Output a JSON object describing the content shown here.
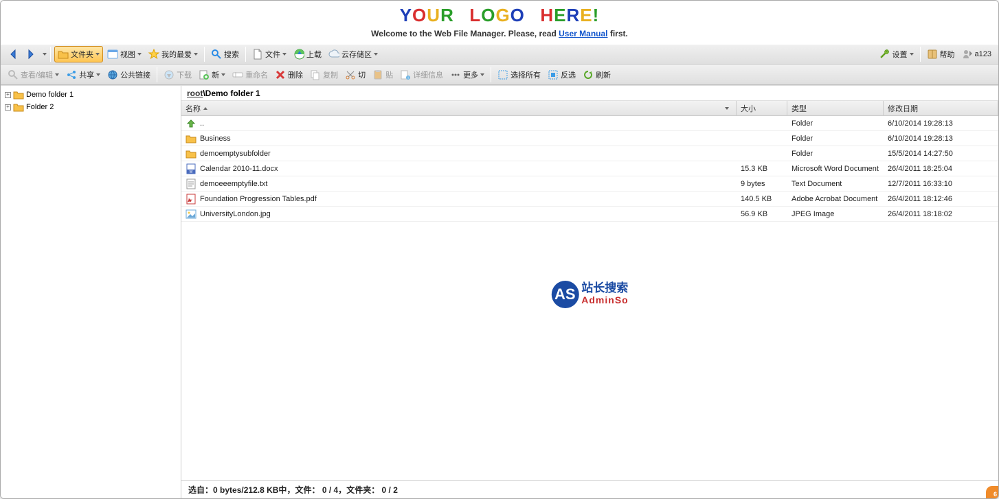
{
  "header": {
    "logo_text": "YOUR LOGO HERE!",
    "welcome_prefix": "Welcome to the Web File Manager. Please, read ",
    "welcome_link": "User Manual",
    "welcome_suffix": " first."
  },
  "toolbar1": {
    "folder_label": "文件夹",
    "view_label": "视图",
    "favorites_label": "我的最爱",
    "search_label": "搜索",
    "file_label": "文件",
    "upload_label": "上载",
    "cloud_label": "云存储区",
    "settings_label": "设置",
    "help_label": "帮助",
    "user_label": "a123"
  },
  "toolbar2": {
    "view_edit_label": "查看/编辑",
    "share_label": "共享",
    "public_links_label": "公共链接",
    "download_label": "下载",
    "new_label": "新",
    "rename_label": "重命名",
    "delete_label": "删除",
    "copy_label": "复制",
    "cut_label": "切",
    "paste_label": "贴",
    "details_label": "详细信息",
    "more_label": "更多",
    "select_all_label": "选择所有",
    "invert_label": "反选",
    "refresh_label": "刷新"
  },
  "sidebar": {
    "items": [
      {
        "label": "Demo folder 1"
      },
      {
        "label": "Folder 2"
      }
    ]
  },
  "breadcrumb": {
    "root": "root",
    "sep": "\\",
    "current": "Demo folder 1"
  },
  "columns": {
    "name": "名称",
    "size": "大小",
    "type": "类型",
    "date": "修改日期"
  },
  "rows": [
    {
      "icon": "up",
      "name": "..",
      "size": "",
      "type": "Folder",
      "date": "6/10/2014 19:28:13"
    },
    {
      "icon": "folder",
      "name": "Business",
      "size": "",
      "type": "Folder",
      "date": "6/10/2014 19:28:13"
    },
    {
      "icon": "folder",
      "name": "demoemptysubfolder",
      "size": "",
      "type": "Folder",
      "date": "15/5/2014 14:27:50"
    },
    {
      "icon": "docx",
      "name": "Calendar 2010-11.docx",
      "size": "15.3 KB",
      "type": "Microsoft Word Document",
      "date": "26/4/2011 18:25:04"
    },
    {
      "icon": "txt",
      "name": "demoeeemptyfile.txt",
      "size": "9 bytes",
      "type": "Text Document",
      "date": "12/7/2011 16:33:10"
    },
    {
      "icon": "pdf",
      "name": "Foundation Progression Tables.pdf",
      "size": "140.5 KB",
      "type": "Adobe Acrobat Document",
      "date": "26/4/2011 18:12:46"
    },
    {
      "icon": "img",
      "name": "UniversityLondon.jpg",
      "size": "56.9 KB",
      "type": "JPEG Image",
      "date": "26/4/2011 18:18:02"
    }
  ],
  "watermark": {
    "abbr": "AS",
    "cn": "站长搜索",
    "en": "AdminSo"
  },
  "status": {
    "selected_label": "选自：",
    "selected_bytes": "0 bytes",
    "total_size": "212.8 KB",
    "of_label": "中",
    "files_label": "文件：",
    "files_count": "0 / 4",
    "folders_label": "文件夹：",
    "folders_count": "0 / 2"
  },
  "corner_badge": "6"
}
